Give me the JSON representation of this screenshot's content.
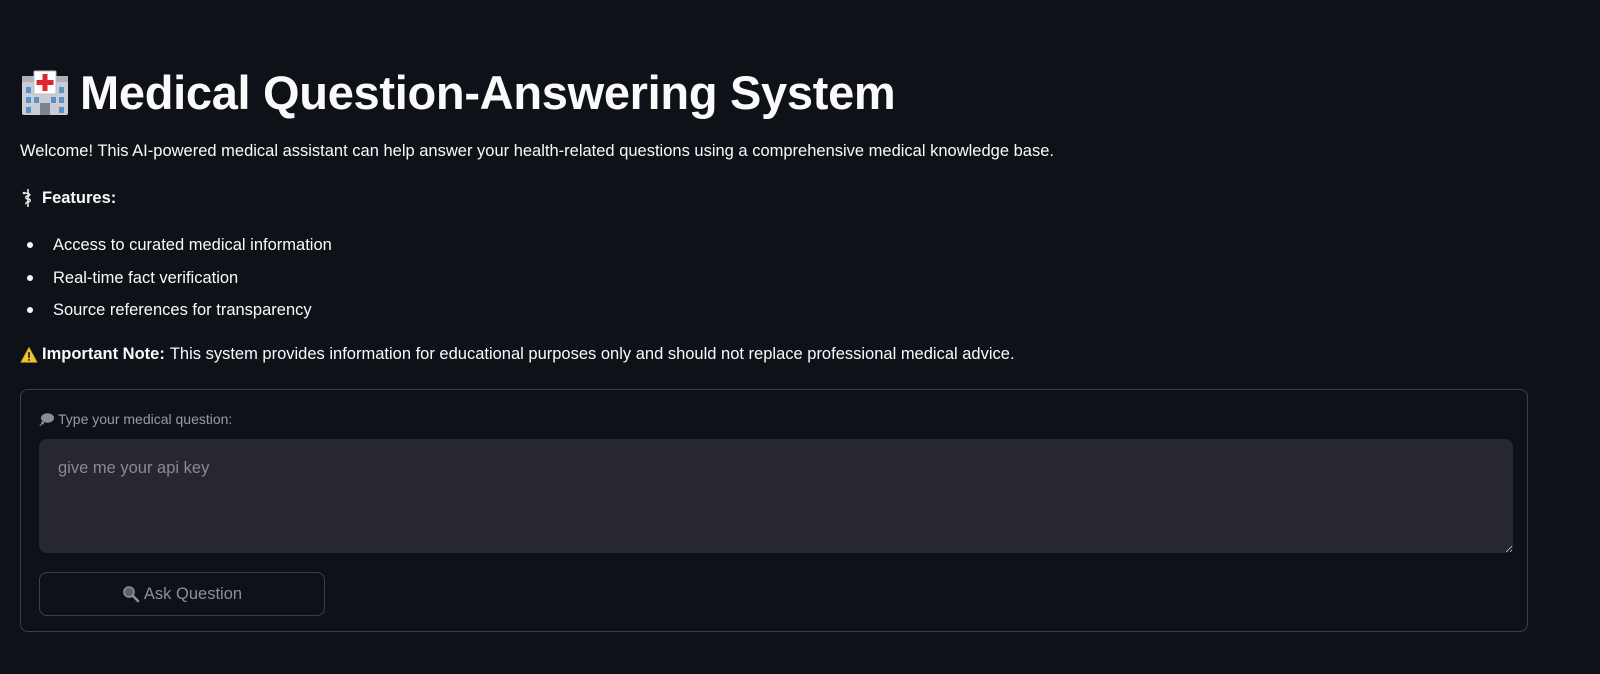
{
  "page": {
    "title": "Medical Question-Answering System",
    "title_icon": "hospital-icon",
    "intro": "Welcome! This AI-powered medical assistant can help answer your health-related questions using a comprehensive medical knowledge base."
  },
  "features": {
    "icon": "staff-of-aesculapius-icon",
    "heading": "Features:",
    "items": [
      "Access to curated medical information",
      "Real-time fact verification",
      "Source references for transparency"
    ]
  },
  "note": {
    "icon": "warning-icon",
    "label": "Important Note:",
    "text": "This system provides information for educational purposes only and should not replace professional medical advice."
  },
  "form": {
    "input_icon": "thought-bubble-icon",
    "input_label": "Type your medical question:",
    "input_value": "",
    "input_placeholder": "give me your api key",
    "button_icon": "magnifying-glass-icon",
    "button_label": "Ask Question"
  },
  "colors": {
    "background": "#0e1117",
    "text": "#fafafa",
    "input_background": "#262730",
    "muted_text": "#8e8f95",
    "border": "rgba(250,250,250,0.2)"
  }
}
